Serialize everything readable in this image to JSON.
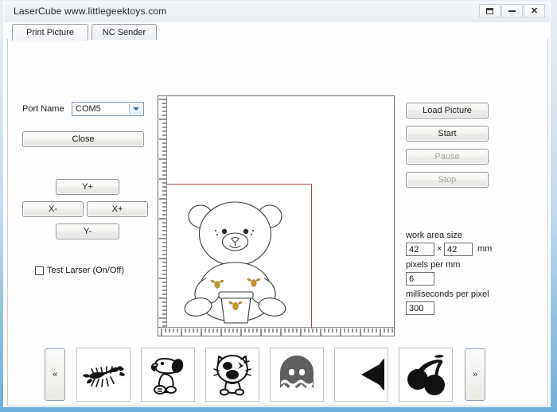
{
  "window": {
    "title": "LaserCube  www.littlegeektoys.com",
    "buttons": [
      {
        "name": "restore-button",
        "glyph": "restore-icon",
        "label": ""
      },
      {
        "name": "minimize-button",
        "glyph": "minimize-icon",
        "label": ""
      },
      {
        "name": "close-button",
        "glyph": "close-icon",
        "label": "✕"
      }
    ]
  },
  "tabs": [
    {
      "label": "Print Picture",
      "active": true
    },
    {
      "label": "NC Sender",
      "active": false
    }
  ],
  "left_panel": {
    "port_label": "Port Name",
    "port_value": "COM5",
    "port_options": [
      "COM5"
    ],
    "close_button": "Close",
    "jog": {
      "y_plus": "Y+",
      "x_minus": "X-",
      "x_plus": "X+",
      "y_minus": "Y-"
    },
    "test_laser_label": "Test Larser (On/Off)",
    "test_laser_checked": false
  },
  "right_panel": {
    "load_picture": "Load Picture",
    "start": "Start",
    "pause": "Pause",
    "stop": "Stop",
    "pause_enabled": false,
    "stop_enabled": false,
    "work_area_label": "work area size",
    "work_width": "42",
    "work_height": "42",
    "dimension_separator": "×",
    "unit": "mm",
    "pixels_per_mm_label": "pixels per mm",
    "pixels_per_mm": "6",
    "ms_per_pixel_label": "milliseconds per pixel",
    "ms_per_pixel": "300"
  },
  "canvas": {
    "preview_name": "teddy-bear-with-honey-pot",
    "work_area_outline_color": "#b34a4a",
    "ruler_unit_ticks": 60
  },
  "thumbnail_strip": {
    "prev_label": "«",
    "next_label": "»",
    "items": [
      {
        "name": "thumb-scorpion",
        "label": "scorpion"
      },
      {
        "name": "thumb-dog",
        "label": "cartoon-dog"
      },
      {
        "name": "thumb-cat",
        "label": "cartoon-cat"
      },
      {
        "name": "thumb-ghost",
        "label": "ghost"
      },
      {
        "name": "thumb-pacman",
        "label": "pac-man"
      },
      {
        "name": "thumb-cherries",
        "label": "cherries"
      }
    ]
  },
  "colors": {
    "window_border": "#6fb0dc",
    "work_area_outline": "#b34a4a",
    "ghost_fill": "#5f5f5f",
    "accent_dropdown": "#31679e"
  }
}
